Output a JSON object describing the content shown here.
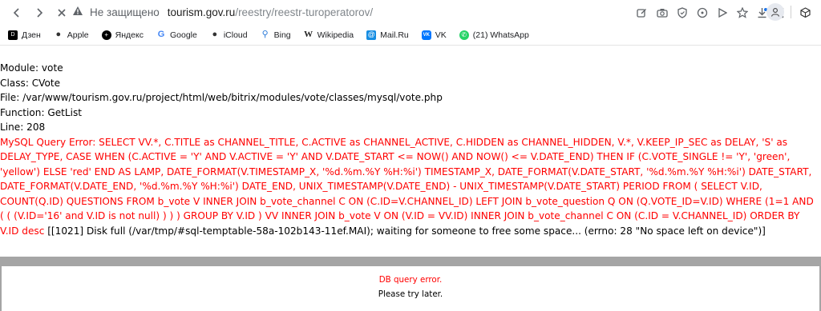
{
  "browser": {
    "security_label": "Не защищено",
    "url_domain": "tourism.gov.ru",
    "url_path": "/reestry/reestr-turoperatorov/"
  },
  "bookmarks": [
    {
      "label": "Дзен",
      "icon": "dzen-icon",
      "glyph": "D"
    },
    {
      "label": "Apple",
      "icon": "apple-icon",
      "glyph": "●"
    },
    {
      "label": "Яндекс",
      "icon": "yandex-icon",
      "glyph": "+"
    },
    {
      "label": "Google",
      "icon": "google-icon",
      "glyph": "G"
    },
    {
      "label": "iCloud",
      "icon": "apple-icon",
      "glyph": "●"
    },
    {
      "label": "Bing",
      "icon": "search-icon",
      "glyph": "⚲"
    },
    {
      "label": "Wikipedia",
      "icon": "wikipedia-icon",
      "glyph": "W"
    },
    {
      "label": "Mail.Ru",
      "icon": "mailru-icon",
      "glyph": "@"
    },
    {
      "label": "VK",
      "icon": "vk-icon",
      "glyph": "VK"
    },
    {
      "label": "(21) WhatsApp",
      "icon": "whatsapp-icon",
      "glyph": "✆"
    }
  ],
  "page": {
    "module": "Module: vote",
    "class": "Class: CVote",
    "file": "File: /var/www/tourism.gov.ru/project/html/web/bitrix/modules/vote/classes/mysql/vote.php",
    "function": "Function: GetList",
    "line": "Line: 208",
    "error": "MySQL Query Error: SELECT VV.*, C.TITLE as CHANNEL_TITLE, C.ACTIVE as CHANNEL_ACTIVE, C.HIDDEN as CHANNEL_HIDDEN, V.*, V.KEEP_IP_SEC as DELAY, 'S' as DELAY_TYPE, CASE WHEN (C.ACTIVE = 'Y' AND V.ACTIVE = 'Y' AND V.DATE_START <= NOW() AND NOW() <= V.DATE_END) THEN IF (C.VOTE_SINGLE != 'Y', 'green', 'yellow') ELSE 'red' END AS LAMP, DATE_FORMAT(V.TIMESTAMP_X, '%d.%m.%Y %H:%i') TIMESTAMP_X, DATE_FORMAT(V.DATE_START, '%d.%m.%Y %H:%i') DATE_START, DATE_FORMAT(V.DATE_END, '%d.%m.%Y %H:%i') DATE_END, UNIX_TIMESTAMP(V.DATE_END) - UNIX_TIMESTAMP(V.DATE_START) PERIOD FROM ( SELECT V.ID, COUNT(Q.ID) QUESTIONS FROM b_vote V INNER JOIN b_vote_channel C ON (C.ID=V.CHANNEL_ID) LEFT JOIN b_vote_question Q ON (Q.VOTE_ID=V.ID) WHERE (1=1 AND ( ( (V.ID='16' and V.ID is not null) ) ) ) GROUP BY V.ID ) VV INNER JOIN b_vote V ON (V.ID = VV.ID) INNER JOIN b_vote_channel C ON (C.ID = V.CHANNEL_ID) ORDER BY V.ID desc",
    "error_tail": " [[1021] Disk full (/var/tmp/#sql-temptable-58a-102b143-11ef.MAI); waiting for someone to free some space... (errno: 28 \"No space left on device\")]"
  },
  "db_box": {
    "error": "DB query error.",
    "hint": "Please try later."
  }
}
